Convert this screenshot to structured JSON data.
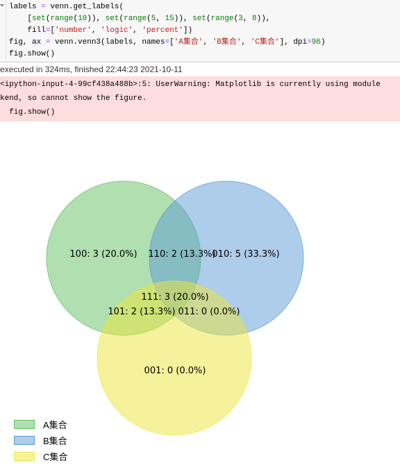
{
  "code": {
    "lines": [
      [
        [
          "k",
          "labels "
        ],
        [
          "op",
          "="
        ],
        [
          "k",
          " venn.get_labels("
        ]
      ],
      [
        [
          "k",
          "    ["
        ],
        [
          "fn",
          "set"
        ],
        [
          "k",
          "("
        ],
        [
          "fn",
          "range"
        ],
        [
          "k",
          "("
        ],
        [
          "num",
          "10"
        ],
        [
          "k",
          ")), "
        ],
        [
          "fn",
          "set"
        ],
        [
          "k",
          "("
        ],
        [
          "fn",
          "range"
        ],
        [
          "k",
          "("
        ],
        [
          "num",
          "5"
        ],
        [
          "k",
          ", "
        ],
        [
          "num",
          "15"
        ],
        [
          "k",
          ")), "
        ],
        [
          "fn",
          "set"
        ],
        [
          "k",
          "("
        ],
        [
          "fn",
          "range"
        ],
        [
          "k",
          "("
        ],
        [
          "num",
          "3"
        ],
        [
          "k",
          ", "
        ],
        [
          "num",
          "8"
        ],
        [
          "k",
          ")),"
        ]
      ],
      [
        [
          "k",
          "    fill"
        ],
        [
          "op",
          "="
        ],
        [
          "k",
          "["
        ],
        [
          "str",
          "'number'"
        ],
        [
          "k",
          ", "
        ],
        [
          "str",
          "'logic'"
        ],
        [
          "k",
          ", "
        ],
        [
          "str",
          "'percent'"
        ],
        [
          "k",
          "])"
        ]
      ],
      [
        [
          "k",
          "fig, ax "
        ],
        [
          "op",
          "="
        ],
        [
          "k",
          " venn.venn3(labels, names"
        ],
        [
          "op",
          "="
        ],
        [
          "k",
          "["
        ],
        [
          "str",
          "'A集合'"
        ],
        [
          "k",
          ", "
        ],
        [
          "str",
          "'B集合'"
        ],
        [
          "k",
          ", "
        ],
        [
          "str",
          "'C集合'"
        ],
        [
          "k",
          "], dpi"
        ],
        [
          "op",
          "="
        ],
        [
          "num",
          "96"
        ],
        [
          "k",
          ")"
        ]
      ],
      [
        [
          "k",
          "fig.show()"
        ]
      ]
    ]
  },
  "status": "executed in 324ms, finished 22:44:23 2021-10-11",
  "warning": [
    "<ipython-input-4-99cf438a488b>:5: UserWarning: Matplotlib is currently using module",
    "kend, so cannot show the figure.",
    "  fig.show()"
  ],
  "chart_data": {
    "type": "venn",
    "sets": [
      {
        "name": "A集合",
        "color": "#61bf61"
      },
      {
        "name": "B集合",
        "color": "#5b9bd5"
      },
      {
        "name": "C集合",
        "color": "#ede63a"
      }
    ],
    "regions": [
      {
        "key": "100",
        "label": "100: 3 (20.0%)"
      },
      {
        "key": "110",
        "label": "110: 2 (13.3%)"
      },
      {
        "key": "010",
        "label": "010: 5 (33.3%)"
      },
      {
        "key": "111",
        "label": "111: 3 (20.0%)"
      },
      {
        "key": "101",
        "label": "101: 2 (13.3%)"
      },
      {
        "key": "011",
        "label": "011: 0 (0.0%)"
      },
      {
        "key": "001",
        "label": "001: 0 (0.0%)"
      }
    ],
    "legend": "lower-left"
  }
}
